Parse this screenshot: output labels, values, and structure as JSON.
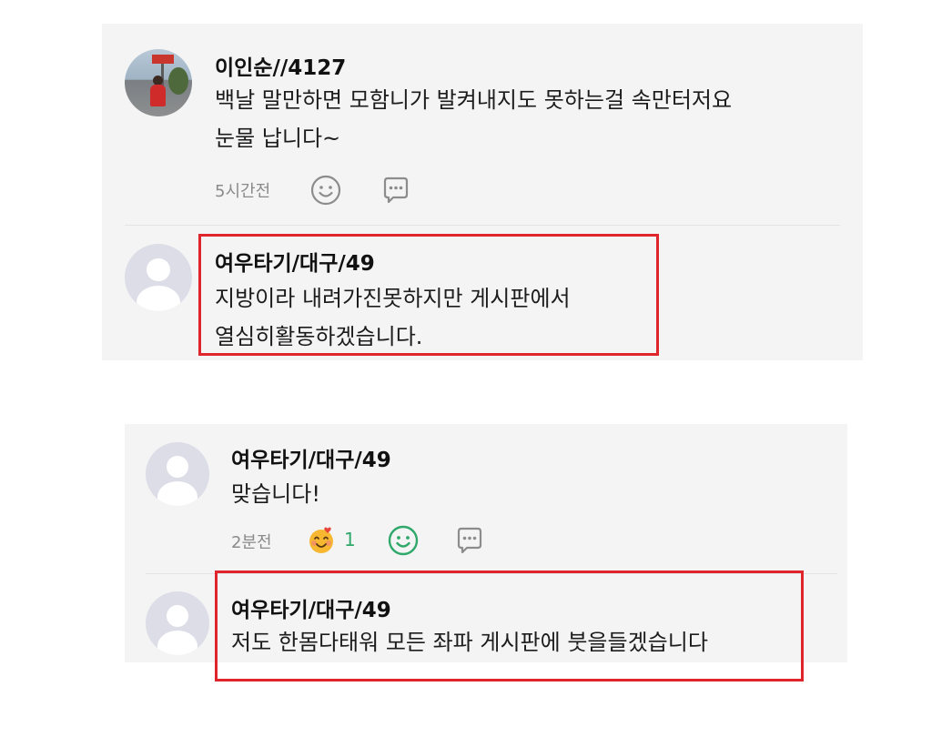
{
  "comments": [
    {
      "author": "이인순//4127",
      "text_line1": "백날  말만하면 모함니가 발켜내지도 못하는걸 속만터저요",
      "text_line2": "눈물 납니다~",
      "time": "5시간전",
      "avatar": "profile-photo"
    },
    {
      "author": "여우타기/대구/49",
      "text_line1": "지방이라 내려가진못하지만 게시판에서",
      "text_line2": "열심히활동하겠습니다.",
      "avatar": "default-avatar",
      "highlighted": true
    },
    {
      "author": "여우타기/대구/49",
      "text_line1": "맞습니다!",
      "time": "2분전",
      "reaction_count": "1",
      "reaction_emoji": "smiling-emoji-with-hearts",
      "avatar": "default-avatar"
    },
    {
      "author": "여우타기/대구/49",
      "text_line1": "저도 한몸다태워 모든 좌파 게시판에 붓을들겠습니다",
      "avatar": "default-avatar",
      "highlighted": true
    }
  ],
  "icons": {
    "like": "smiley-icon",
    "reply": "speech-bubble-icon"
  },
  "colors": {
    "highlight": "#e0242c",
    "like_active": "#2fa86a",
    "panel_background": "#f4f4f5"
  }
}
